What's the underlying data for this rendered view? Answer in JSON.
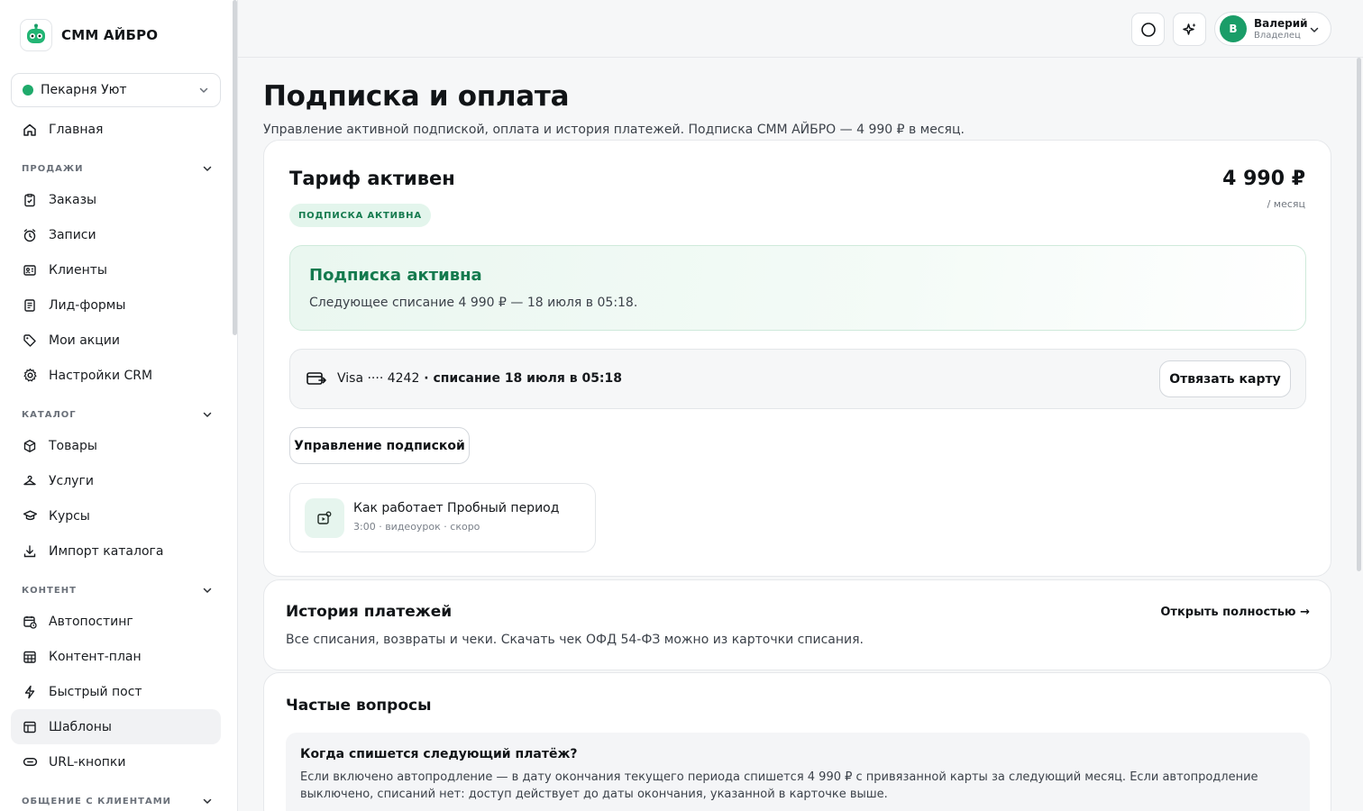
{
  "brand": {
    "name": "СММ АЙБРО"
  },
  "workspace": {
    "name": "Пекарня Уют",
    "status_color": "#1faa6b"
  },
  "sidebar": {
    "home": {
      "label": "Главная",
      "icon": "home-icon"
    },
    "sections": [
      {
        "label": "ПРОДАЖИ",
        "items": [
          {
            "label": "Заказы",
            "icon": "clipboard-icon"
          },
          {
            "label": "Записи",
            "icon": "clock-icon"
          },
          {
            "label": "Клиенты",
            "icon": "contacts-icon"
          },
          {
            "label": "Лид-формы",
            "icon": "form-icon"
          },
          {
            "label": "Мои акции",
            "icon": "tag-icon"
          },
          {
            "label": "Настройки CRM",
            "icon": "gear-icon"
          }
        ]
      },
      {
        "label": "КАТАЛОГ",
        "items": [
          {
            "label": "Товары",
            "icon": "box-icon"
          },
          {
            "label": "Услуги",
            "icon": "hanger-icon"
          },
          {
            "label": "Курсы",
            "icon": "graduation-cap-icon"
          },
          {
            "label": "Импорт каталога",
            "icon": "download-icon"
          }
        ]
      },
      {
        "label": "КОНТЕНТ",
        "items": [
          {
            "label": "Автопостинг",
            "icon": "calendar-clock-icon"
          },
          {
            "label": "Контент-план",
            "icon": "grid-calendar-icon"
          },
          {
            "label": "Быстрый пост",
            "icon": "lightning-icon"
          },
          {
            "label": "Шаблоны",
            "icon": "layout-icon",
            "active": true
          },
          {
            "label": "URL-кнопки",
            "icon": "link-button-icon"
          }
        ]
      },
      {
        "label": "ОБЩЕНИЕ С КЛИЕНТАМИ",
        "items": []
      }
    ]
  },
  "topbar": {
    "user": {
      "initial": "В",
      "name": "Валерий",
      "role": "Владелец"
    }
  },
  "page": {
    "title": "Подписка и оплата",
    "subtitle": "Управление активной подпиской, оплата и история платежей. Подписка СММ АЙБРО — 4 990 ₽ в месяц."
  },
  "plan": {
    "title": "Тариф активен",
    "status_badge": "ПОДПИСКА АКТИВНА",
    "price": "4 990 ₽",
    "period": "/ месяц",
    "active_title": "Подписка активна",
    "active_text": "Следующее списание 4 990 ₽ — 18 июля в 05:18.",
    "card_brand": "Visa ···· 4242",
    "card_charge": " · списание 18 июля в 05:18",
    "unlink_button": "Отвязать карту",
    "manage_button": "Управление подпиской",
    "video": {
      "title": "Как работает Пробный период",
      "meta": "3:00 · видеоурок · скоро"
    }
  },
  "history": {
    "title": "История платежей",
    "link": "Открыть полностью →",
    "text": "Все списания, возвраты и чеки. Скачать чек ОФД 54-ФЗ можно из карточки списания."
  },
  "faq": {
    "title": "Частые вопросы",
    "items": [
      {
        "question": "Когда спишется следующий платёж?",
        "answer": "Если включено автопродление — в дату окончания текущего периода спишется 4 990 ₽ с привязанной карты за следующий месяц. Если автопродление выключено, списаний нет: доступ действует до даты окончания, указанной в карточке выше."
      }
    ]
  },
  "colors": {
    "accent": "#1a9d68",
    "accent_text": "#147a4e",
    "badge_bg": "#e3f5ec"
  }
}
